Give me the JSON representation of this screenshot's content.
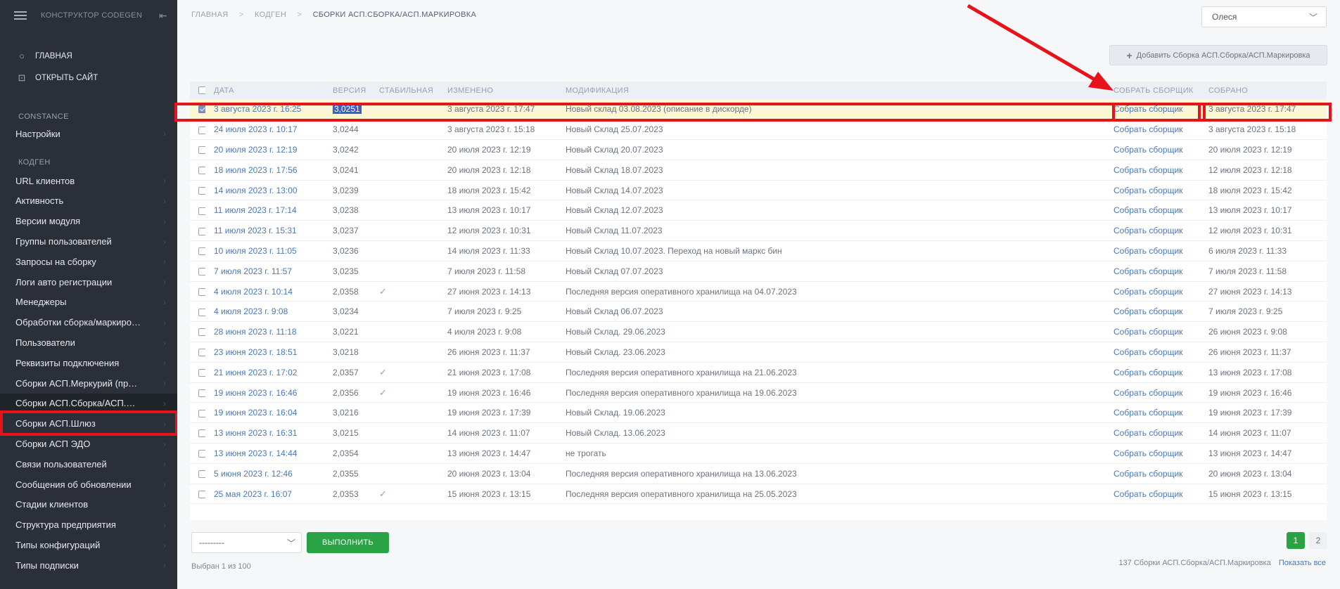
{
  "sidebar": {
    "title": "КОНСТРУКТОР CODEGEN",
    "top_items": [
      {
        "label": "ГЛАВНАЯ"
      },
      {
        "label": "ОТКРЫТЬ САЙТ"
      }
    ],
    "section_constance": "CONSTANCE",
    "constance_items": [
      {
        "label": "Настройки"
      }
    ],
    "section_codegen": "КОДГЕН",
    "codegen_items": [
      {
        "label": "URL клиентов"
      },
      {
        "label": "Активность"
      },
      {
        "label": "Версии модуля"
      },
      {
        "label": "Группы пользователей"
      },
      {
        "label": "Запросы на сборку"
      },
      {
        "label": "Логи авто регистрации"
      },
      {
        "label": "Менеджеры"
      },
      {
        "label": "Обработки сборка/маркиро…"
      },
      {
        "label": "Пользователи"
      },
      {
        "label": "Реквизиты подключения"
      },
      {
        "label": "Сборки АСП.Меркурий (пр…"
      },
      {
        "label": "Сборки АСП.Сборка/АСП.…"
      },
      {
        "label": "Сборки АСП.Шлюз"
      },
      {
        "label": "Сборки АСП ЭДО"
      },
      {
        "label": "Связи пользователей"
      },
      {
        "label": "Сообщения об обновлении"
      },
      {
        "label": "Стадии клиентов"
      },
      {
        "label": "Структура предприятия"
      },
      {
        "label": "Типы конфигураций"
      },
      {
        "label": "Типы подписки"
      }
    ]
  },
  "breadcrumb": {
    "home": "ГЛАВНАЯ",
    "section": "КОДГЕН",
    "current": "СБОРКИ АСП.СБОРКА/АСП.МАРКИРОВКА",
    "sep": ">"
  },
  "user": {
    "name": "Олеся"
  },
  "add_button": {
    "label": "Добавить Сборка АСП.Сборка/АСП.Маркировка"
  },
  "table": {
    "headers": {
      "date": "ДАТА",
      "version": "ВЕРСИЯ",
      "stable": "СТАБИЛЬНАЯ",
      "changed": "ИЗМЕНЕНО",
      "modification": "МОДИФИКАЦИЯ",
      "build": "СОБРАТЬ СБОРЩИК",
      "built": "СОБРАНО"
    },
    "rows": [
      {
        "date": "3 августа 2023 г. 16:25",
        "version": "3,0251",
        "stable": "",
        "changed": "3 августа 2023 г. 17:47",
        "mod": "Новый склад 03.08.2023 (описание в дискорде)",
        "build": "Собрать сборщик",
        "built": "3 августа 2023 г. 17:47"
      },
      {
        "date": "24 июля 2023 г. 10:17",
        "version": "3,0244",
        "stable": "",
        "changed": "3 августа 2023 г. 15:18",
        "mod": "Новый Склад 25.07.2023",
        "build": "Собрать сборщик",
        "built": "3 августа 2023 г. 15:18"
      },
      {
        "date": "20 июля 2023 г. 12:19",
        "version": "3,0242",
        "stable": "",
        "changed": "20 июля 2023 г. 12:19",
        "mod": "Новый Склад 20.07.2023",
        "build": "Собрать сборщик",
        "built": "20 июля 2023 г. 12:19"
      },
      {
        "date": "18 июля 2023 г. 17:56",
        "version": "3,0241",
        "stable": "",
        "changed": "20 июля 2023 г. 12:18",
        "mod": "Новый Склад 18.07.2023",
        "build": "Собрать сборщик",
        "built": "12 июля 2023 г. 12:18"
      },
      {
        "date": "14 июля 2023 г. 13:00",
        "version": "3,0239",
        "stable": "",
        "changed": "18 июля 2023 г. 15:42",
        "mod": "Новый Склад 14.07.2023",
        "build": "Собрать сборщик",
        "built": "18 июля 2023 г. 15:42"
      },
      {
        "date": "11 июля 2023 г. 17:14",
        "version": "3,0238",
        "stable": "",
        "changed": "13 июля 2023 г. 10:17",
        "mod": "Новый Склад 12.07.2023",
        "build": "Собрать сборщик",
        "built": "13 июля 2023 г. 10:17"
      },
      {
        "date": "11 июля 2023 г. 15:31",
        "version": "3,0237",
        "stable": "",
        "changed": "12 июля 2023 г. 10:31",
        "mod": "Новый Склад 11.07.2023",
        "build": "Собрать сборщик",
        "built": "12 июля 2023 г. 10:31"
      },
      {
        "date": "10 июля 2023 г. 11:05",
        "version": "3,0236",
        "stable": "",
        "changed": "14 июля 2023 г. 11:33",
        "mod": "Новый Склад 10.07.2023. Переход на новый маркс бин",
        "build": "Собрать сборщик",
        "built": "6 июля 2023 г. 11:33"
      },
      {
        "date": "7 июля 2023 г. 11:57",
        "version": "3,0235",
        "stable": "",
        "changed": "7 июля 2023 г. 11:58",
        "mod": "Новый Склад 07.07.2023",
        "build": "Собрать сборщик",
        "built": "7 июля 2023 г. 11:58"
      },
      {
        "date": "4 июля 2023 г. 10:14",
        "version": "2,0358",
        "stable": "✓",
        "changed": "27 июня 2023 г. 14:13",
        "mod": "Последняя версия оперативного хранилища на 04.07.2023",
        "build": "Собрать сборщик",
        "built": "27 июня 2023 г. 14:13"
      },
      {
        "date": "4 июля 2023 г. 9:08",
        "version": "3,0234",
        "stable": "",
        "changed": "7 июля 2023 г. 9:25",
        "mod": "Новый Склад 06.07.2023",
        "build": "Собрать сборщик",
        "built": "7 июля 2023 г. 9:25"
      },
      {
        "date": "28 июня 2023 г. 11:18",
        "version": "3,0221",
        "stable": "",
        "changed": "4 июля 2023 г. 9:08",
        "mod": "Новый Склад. 29.06.2023",
        "build": "Собрать сборщик",
        "built": "26 июня 2023 г. 9:08"
      },
      {
        "date": "23 июня 2023 г. 18:51",
        "version": "3,0218",
        "stable": "",
        "changed": "26 июня 2023 г. 11:37",
        "mod": "Новый Склад. 23.06.2023",
        "build": "Собрать сборщик",
        "built": "26 июня 2023 г. 11:37"
      },
      {
        "date": "21 июня 2023 г. 17:02",
        "version": "2,0357",
        "stable": "✓",
        "changed": "21 июня 2023 г. 17:08",
        "mod": "Последняя версия оперативного хранилища на 21.06.2023",
        "build": "Собрать сборщик",
        "built": "13 июня 2023 г. 17:08"
      },
      {
        "date": "19 июня 2023 г. 16:46",
        "version": "2,0356",
        "stable": "✓",
        "changed": "19 июня 2023 г. 16:46",
        "mod": "Последняя версия оперативного хранилища на 19.06.2023",
        "build": "Собрать сборщик",
        "built": "19 июня 2023 г. 16:46"
      },
      {
        "date": "19 июня 2023 г. 16:04",
        "version": "3,0216",
        "stable": "",
        "changed": "19 июня 2023 г. 17:39",
        "mod": "Новый Склад. 19.06.2023",
        "build": "Собрать сборщик",
        "built": "19 июня 2023 г. 17:39"
      },
      {
        "date": "13 июня 2023 г. 16:31",
        "version": "3,0215",
        "stable": "",
        "changed": "14 июня 2023 г. 11:07",
        "mod": "Новый Склад. 13.06.2023",
        "build": "Собрать сборщик",
        "built": "14 июня 2023 г. 11:07"
      },
      {
        "date": "13 июня 2023 г. 14:44",
        "version": "2,0354",
        "stable": "",
        "changed": "13 июня 2023 г. 14:47",
        "mod": "не трогать",
        "build": "Собрать сборщик",
        "built": "13 июня 2023 г. 14:47"
      },
      {
        "date": "5 июня 2023 г. 12:46",
        "version": "2,0355",
        "stable": "",
        "changed": "20 июня 2023 г. 13:04",
        "mod": "Последняя версия оперативного хранилища на 13.06.2023",
        "build": "Собрать сборщик",
        "built": "20 июня 2023 г. 13:04"
      },
      {
        "date": "25 мая 2023 г. 16:07",
        "version": "2,0353",
        "stable": "✓",
        "changed": "15 июня 2023 г. 13:15",
        "mod": "Последняя версия оперативного хранилища на 25.05.2023",
        "build": "Собрать сборщик",
        "built": "15 июня 2023 г. 13:15"
      }
    ]
  },
  "footer": {
    "action_select": "---------",
    "run_label": "ВЫПОЛНИТЬ",
    "selected": "Выбран 1 из 100",
    "total": "137 Сборки АСП.Сборка/АСП.Маркировка",
    "show_all": "Показать все",
    "pages": [
      "1",
      "2"
    ]
  },
  "colors": {
    "sidebar_bg": "#2b2f38",
    "accent_green": "#2aa347",
    "link_blue": "#4a78b5",
    "annotation_red": "#e8121a",
    "selected_row": "#fbf6d4"
  }
}
